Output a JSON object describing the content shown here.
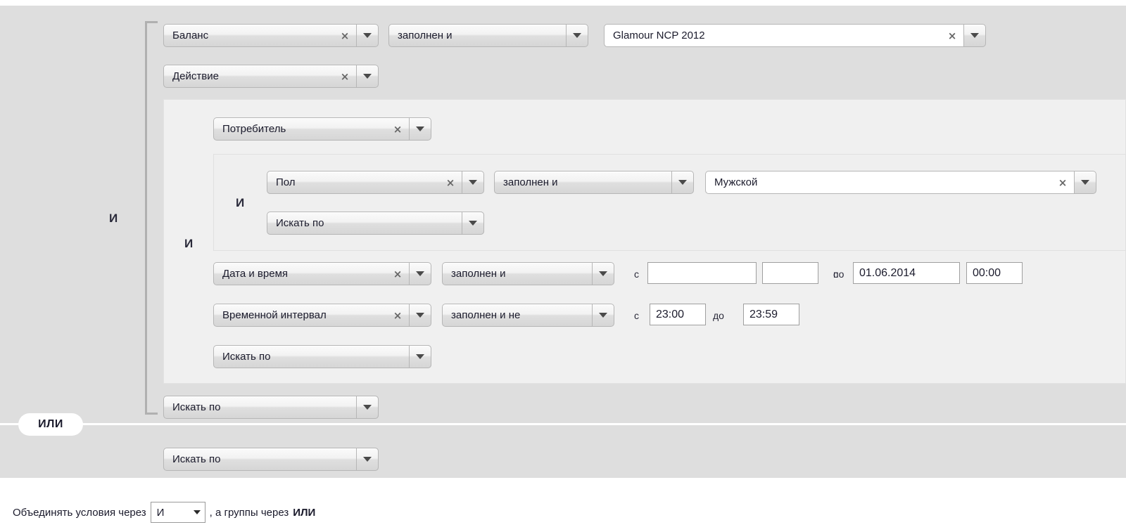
{
  "colors": {
    "canvas": "#dedede",
    "panel": "#f0f0f0",
    "bracket": "#b0b0b0",
    "control_border": "#b6b6b6",
    "text": "#1b1b2c"
  },
  "icons": {
    "clear": "×",
    "dropdown": "dropdown-arrow-icon"
  },
  "group_root": {
    "operator_label": "И"
  },
  "rows": {
    "balance": {
      "field": "Баланс",
      "operator": "заполнен и",
      "value": "Glamour NCP 2012"
    },
    "action": {
      "field": "Действие"
    },
    "consumer": {
      "field": "Потребитель"
    },
    "gender": {
      "field": "Пол",
      "operator": "заполнен и",
      "value": "Мужской"
    },
    "gender_group_operator": "И",
    "inner_group_operator": "И",
    "search_by_gender_group": "Искать по",
    "datetime": {
      "field": "Дата и время",
      "operator": "заполнен и",
      "from_label": "с",
      "from_date": "",
      "from_time": "",
      "to_label": "по",
      "to_date": "01.06.2014",
      "to_time": "00:00"
    },
    "timeinterval": {
      "field": "Временной интервал",
      "operator": "заполнен и не",
      "from_label": "с",
      "from_time": "23:00",
      "to_label": "до",
      "to_time": "23:59"
    },
    "search_by_inner": "Искать по",
    "search_by_group": "Искать по",
    "search_by_second_group": "Искать по"
  },
  "separator": {
    "label": "ИЛИ"
  },
  "footer": {
    "prefix": "Объединять условия через",
    "selected": "И",
    "middle": ", а группы через",
    "group_operator": "ИЛИ"
  }
}
